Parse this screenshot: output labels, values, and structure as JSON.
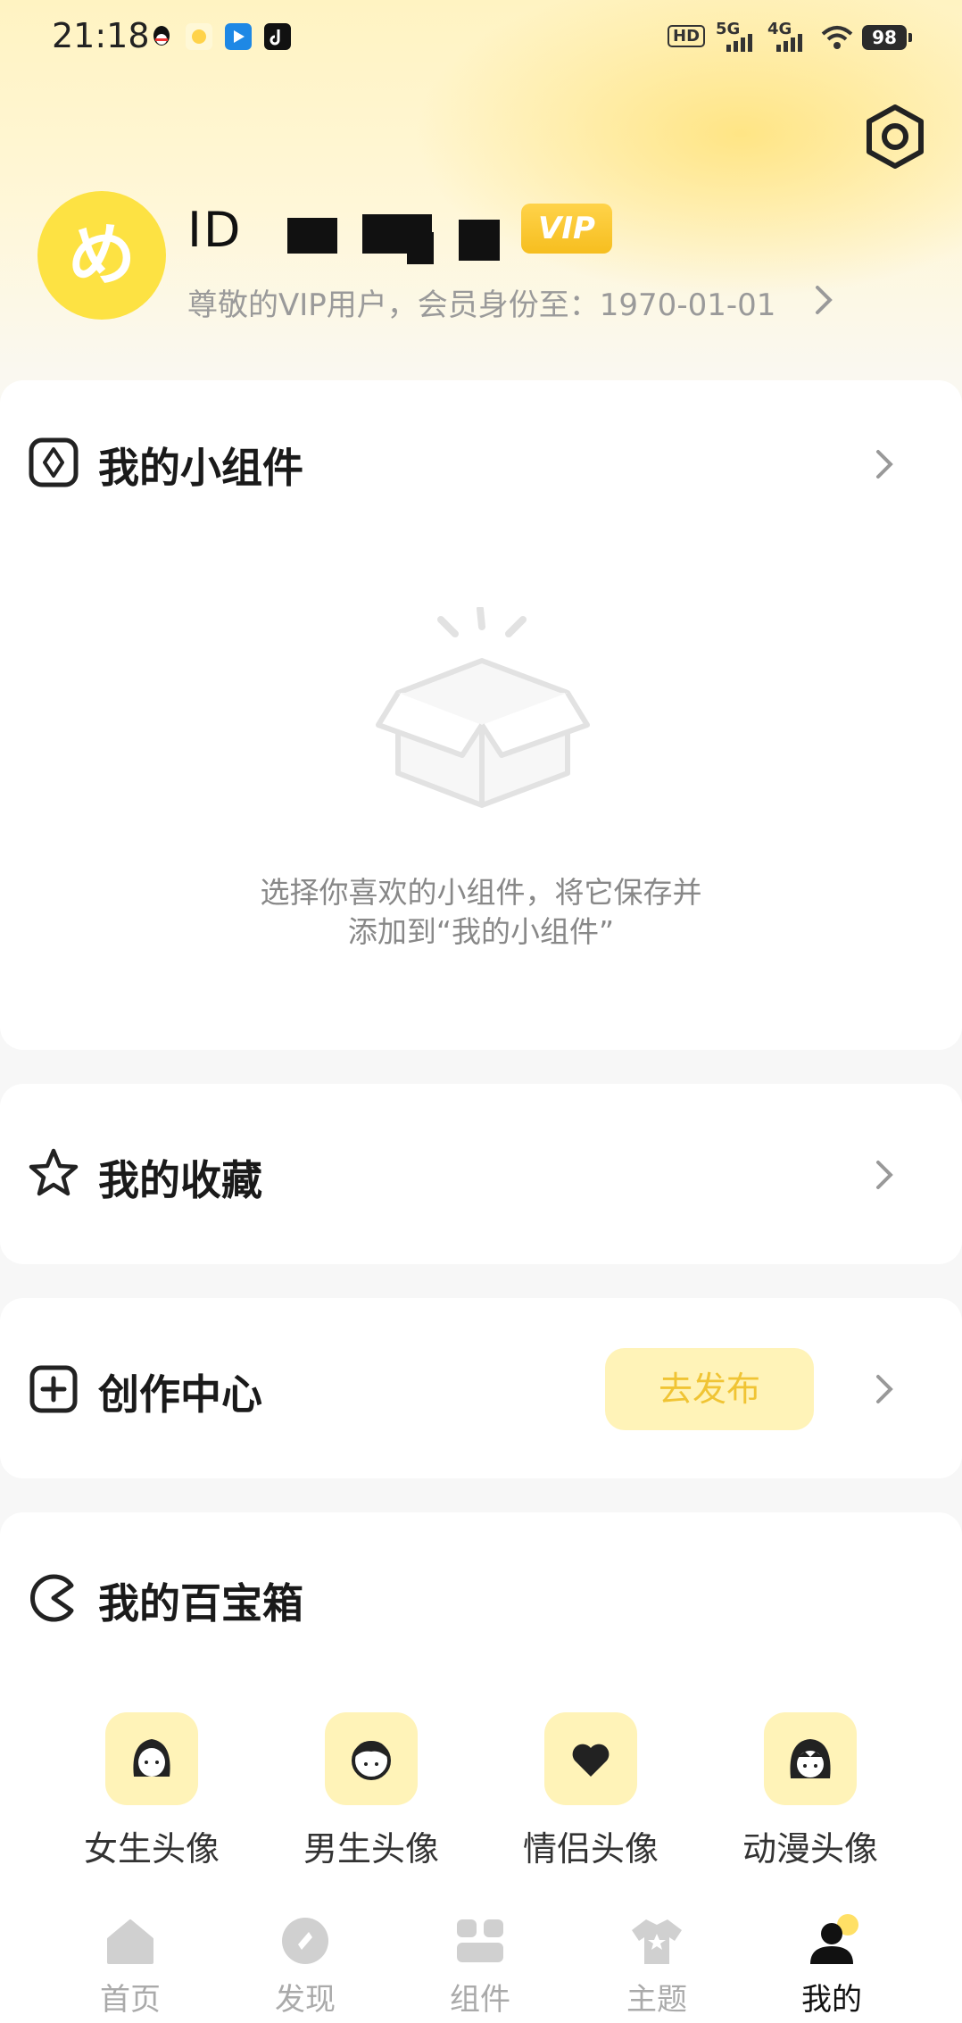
{
  "status_bar": {
    "time": "21:18",
    "hd": "HD",
    "net1": "5G",
    "net2": "4G",
    "battery": "98"
  },
  "profile": {
    "avatar_glyph": "め",
    "name_visible": "ID",
    "vip_badge": "VIP",
    "member_text": "尊敬的VIP用户，会员身份至：1970-01-01"
  },
  "widgets_card": {
    "title": "我的小组件",
    "empty_line1": "选择你喜欢的小组件，将它保存并",
    "empty_line2": "添加到“我的小组件”"
  },
  "favorites_card": {
    "title": "我的收藏"
  },
  "creation_card": {
    "title": "创作中心",
    "publish_label": "去发布"
  },
  "toolbox_card": {
    "title": "我的百宝箱",
    "items": [
      {
        "label": "女生头像",
        "icon": "girl-face-icon"
      },
      {
        "label": "男生头像",
        "icon": "boy-face-icon"
      },
      {
        "label": "情侣头像",
        "icon": "heart-icon"
      },
      {
        "label": "动漫头像",
        "icon": "anime-face-icon"
      }
    ]
  },
  "bottom_nav": [
    {
      "label": "首页",
      "icon": "home-icon",
      "active": false
    },
    {
      "label": "发现",
      "icon": "discover-icon",
      "active": false
    },
    {
      "label": "组件",
      "icon": "widgets-icon",
      "active": false
    },
    {
      "label": "主题",
      "icon": "theme-shirt-icon",
      "active": false
    },
    {
      "label": "我的",
      "icon": "profile-icon",
      "active": true
    }
  ],
  "colors": {
    "accent_yellow": "#fde243",
    "tile_yellow": "#fff3b8",
    "publish_text": "#f0c434"
  }
}
